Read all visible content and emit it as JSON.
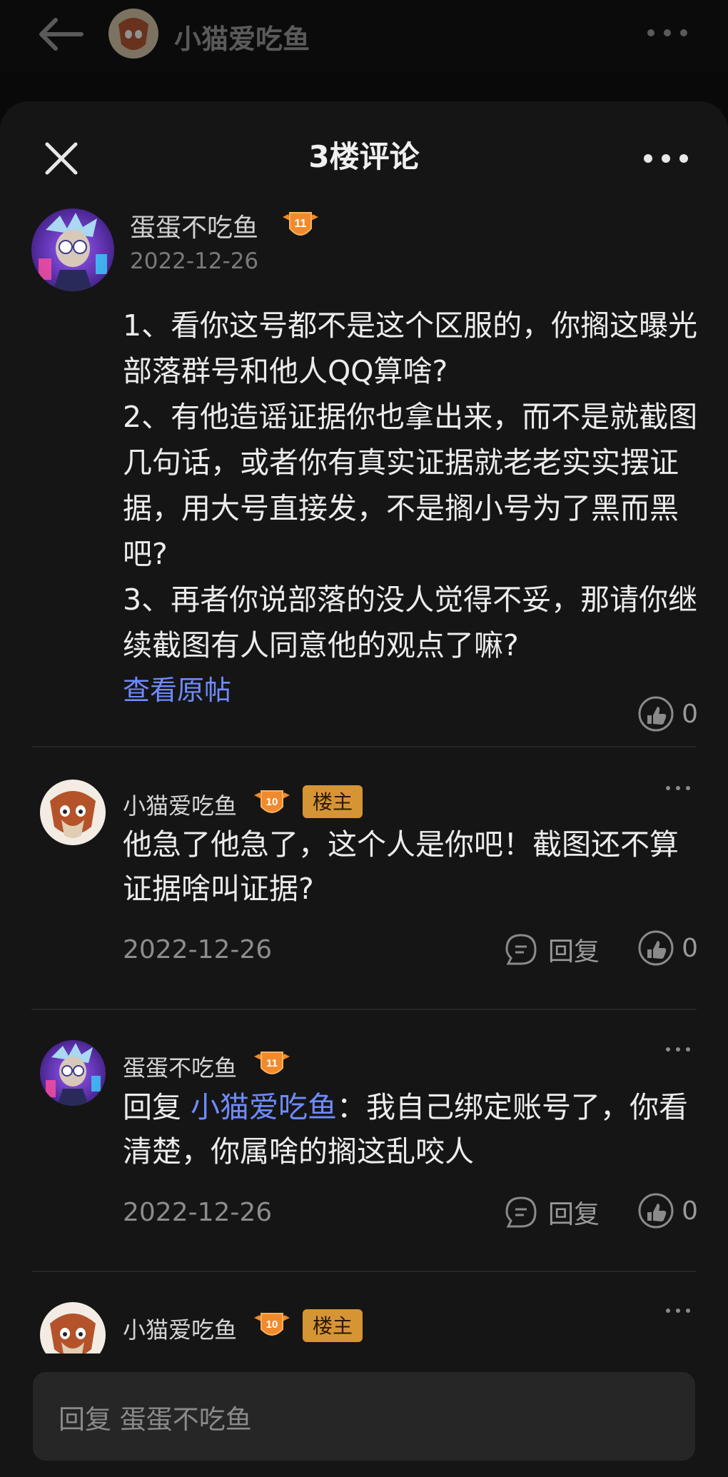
{
  "background_header": {
    "title": "小猫爱吃鱼"
  },
  "sheet": {
    "title": "3楼评论"
  },
  "main_post": {
    "author": "蛋蛋不吃鱼",
    "level": "11",
    "date": "2022-12-26",
    "body": "1、看你这号都不是这个区服的，你搁这曝光部落群号和他人QQ算啥?\n2、有他造谣证据你也拿出来，而不是就截图几句话，或者你有真实证据就老老实实摆证据，用大号直接发，不是搁小号为了黑而黑吧?\n3、再者你说部落的没人觉得不妥，那请你继续截图有人同意他的观点了嘛?",
    "view_original_label": "查看原帖",
    "likes": "0"
  },
  "replies": [
    {
      "author": "小猫爱吃鱼",
      "level": "10",
      "owner_tag": "楼主",
      "text": "他急了他急了，这个人是你吧！截图还不算证据啥叫证据?",
      "date": "2022-12-26",
      "reply_label": "回复",
      "likes": "0"
    },
    {
      "author": "蛋蛋不吃鱼",
      "level": "11",
      "reply_prefix": "回复 ",
      "reply_to": "小猫爱吃鱼",
      "text": "：我自己绑定账号了，你看清楚，你属啥的搁这乱咬人",
      "date": "2022-12-26",
      "reply_label": "回复",
      "likes": "0"
    },
    {
      "author": "小猫爱吃鱼",
      "level": "10",
      "owner_tag": "楼主"
    }
  ],
  "input": {
    "placeholder": "回复 蛋蛋不吃鱼"
  },
  "colors": {
    "background": "#090909",
    "sheet": "#151515",
    "link": "#6f8bff",
    "owner_tag": "#d69535",
    "level_badge": "#f08a2c"
  }
}
